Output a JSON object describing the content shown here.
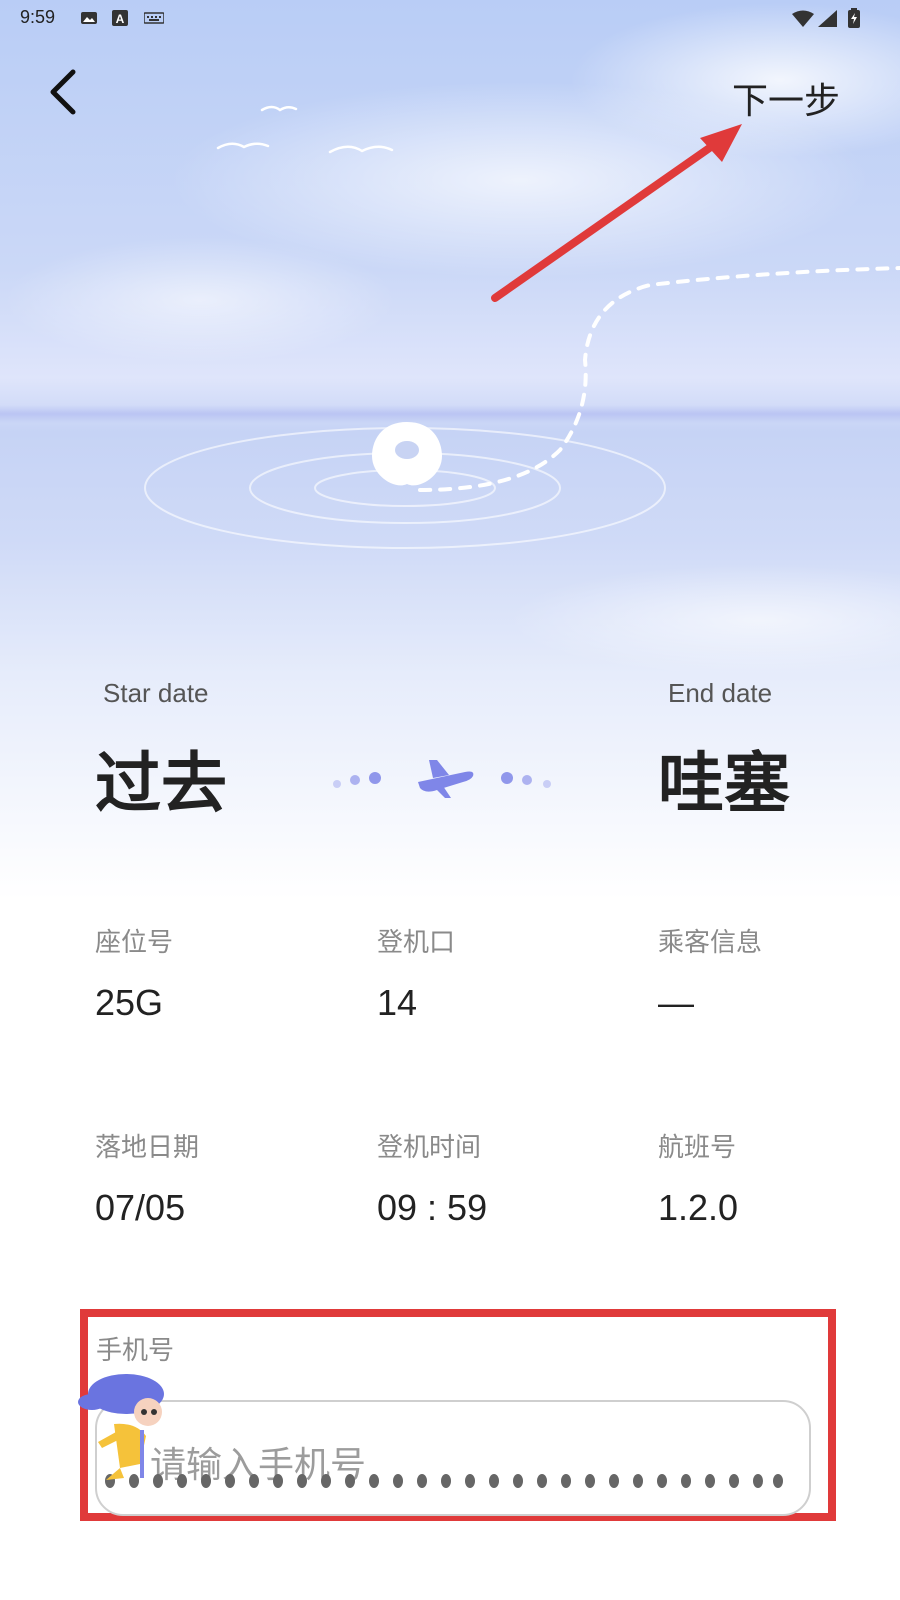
{
  "status_bar": {
    "time": "9:59",
    "icons": [
      "image-icon",
      "text-a-icon",
      "keyboard-icon",
      "wifi-icon",
      "signal-icon",
      "battery-icon"
    ]
  },
  "header": {
    "back_icon": "chevron-left-icon",
    "next_label": "下一步"
  },
  "trip": {
    "start_label": "Star date",
    "start_city": "过去",
    "end_label": "End date",
    "end_city": "哇塞"
  },
  "info_fields": [
    {
      "label": "座位号",
      "value": "25G"
    },
    {
      "label": "登机口",
      "value": "14"
    },
    {
      "label": "乘客信息",
      "value": "—"
    },
    {
      "label": "落地日期",
      "value": "07/05"
    },
    {
      "label": "登机时间",
      "value": "09 : 59"
    },
    {
      "label": "航班号",
      "value": "1.2.0"
    }
  ],
  "phone": {
    "label": "手机号",
    "placeholder": "请输入手机号",
    "value": ""
  },
  "colors": {
    "annotation_red": "#e03a3a",
    "plane_blue": "#7f86e8",
    "text_dark": "#222222",
    "text_muted": "#8a8a8a"
  }
}
